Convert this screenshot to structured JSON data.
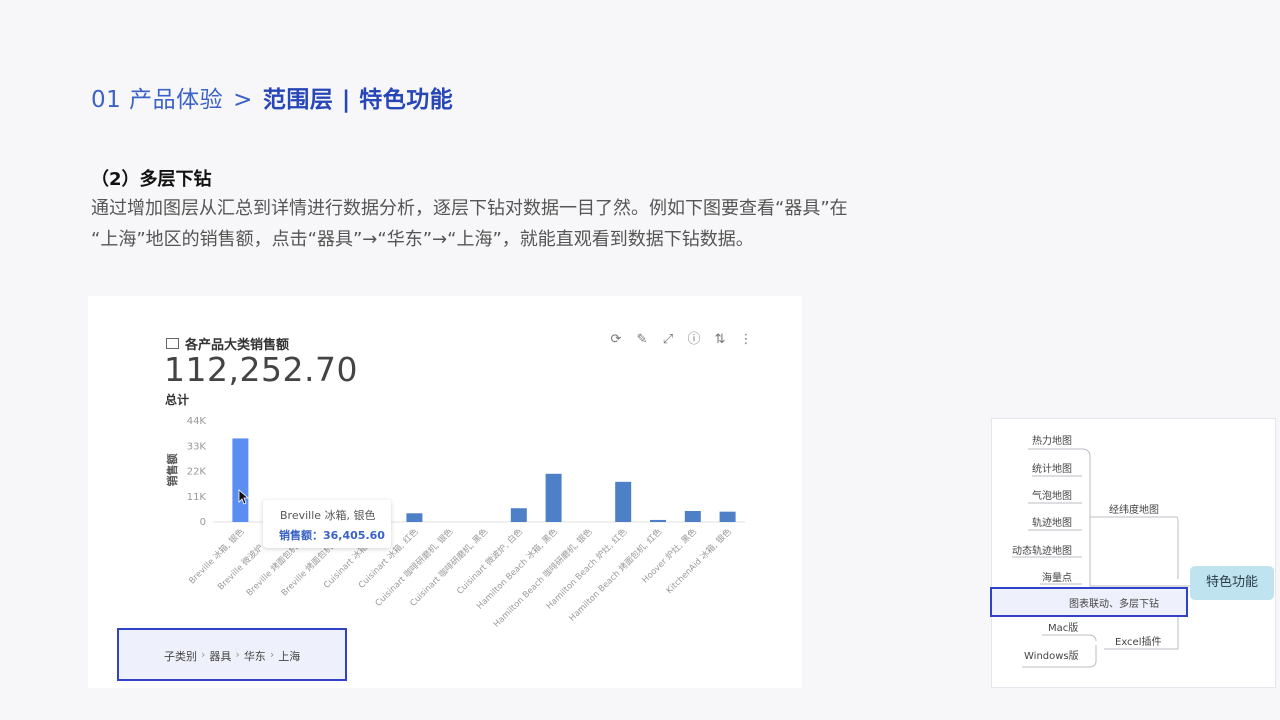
{
  "breadcrumb": {
    "section": "01 产品体验",
    "separator": ">",
    "current": "范围层 | 特色功能"
  },
  "heading": "（2）多层下钻",
  "description": [
    "通过增加图层从汇总到详情进行数据分析，逐层下钻对数据一目了然。例如下图要查看“器具”在",
    "“上海”地区的销售额，点击“器具”→“华东”→“上海”，就能直观看到数据下钻数据。"
  ],
  "screenshot": {
    "card_title": "各产品大类销售额",
    "total_value": "112,252.70",
    "total_label": "总计",
    "toolbar_icons": [
      "refresh-icon",
      "edit-icon",
      "expand-icon",
      "info-icon",
      "sort-icon",
      "more-icon"
    ],
    "tooltip": {
      "title": "Breville 冰箱, 银色",
      "value": "销售额：36,405.60"
    },
    "drill_path": [
      "子类别",
      "器具",
      "华东",
      "上海"
    ],
    "colors": {
      "bar": "#4d80c6",
      "bar_highlight": "#5b8ef0",
      "accent": "#3042c8"
    }
  },
  "chart_data": {
    "type": "bar",
    "ylabel": "销售额",
    "yticks": [
      "44K",
      "33K",
      "22K",
      "11K",
      "0"
    ],
    "ylim": [
      0,
      44000
    ],
    "categories": [
      "Breville 冰箱, 银色",
      "Breville 微波炉, 黑色",
      "Breville 烤面包机, 黑色",
      "Breville 烤面包机, 白色",
      "Cuisinart 冰箱, 白色",
      "Cuisinart 冰箱, 红色",
      "Cuisinart 咖啡研磨机, 银色",
      "Cuisinart 咖啡研磨机, 黑色",
      "Cuisinart 微波炉, 白色",
      "Hamilton Beach 冰箱, 黑色",
      "Hamilton Beach 咖啡研磨机, 银色",
      "Hamilton Beach 炉灶, 红色",
      "Hamilton Beach 烤面包机, 红色",
      "Hoover 炉灶, 黑色",
      "KitchenAid 冰箱, 银色"
    ],
    "values": [
      36405.6,
      0,
      0,
      0,
      0,
      3800,
      0,
      0,
      6000,
      21000,
      0,
      17500,
      900,
      4800,
      4500
    ]
  },
  "mindmap": {
    "root": "特色功能",
    "branches": [
      {
        "label": "经纬度地图",
        "children": [
          "热力地图",
          "统计地图",
          "气泡地图",
          "轨迹地图",
          "动态轨迹地图",
          "海量点"
        ]
      },
      {
        "label": "图表联动、多层下钻",
        "children": []
      },
      {
        "label": "Excel插件",
        "children": [
          "Mac版",
          "Windows版"
        ]
      }
    ]
  }
}
